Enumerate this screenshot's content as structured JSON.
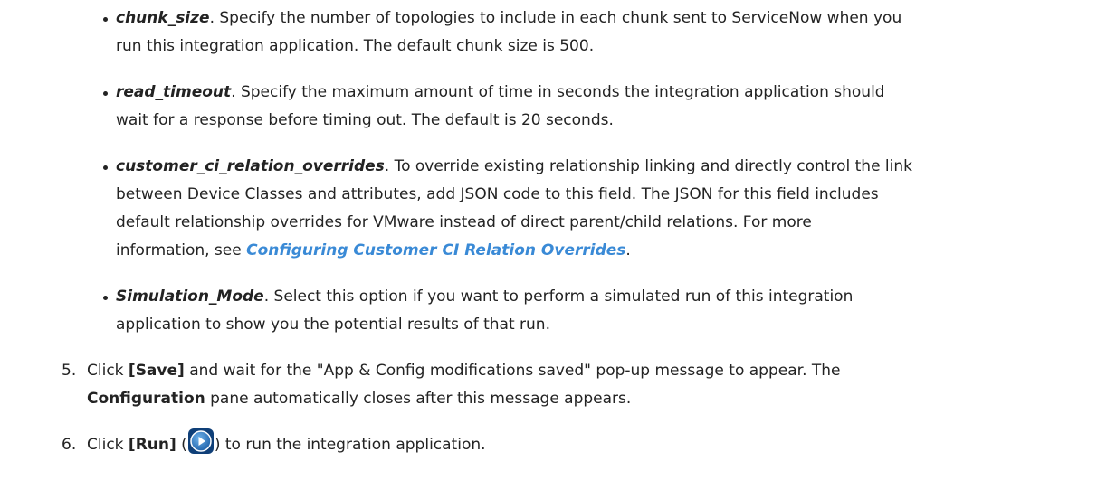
{
  "bullets": [
    {
      "term": "chunk_size",
      "line1": ". Specify the number of topologies to include in each chunk sent to ServiceNow when you",
      "line2": "run this integration application. The default chunk size is 500."
    },
    {
      "term": "read_timeout",
      "line1": ". Specify the maximum amount of time in seconds the integration application should",
      "line2": "wait for a response before timing out. The default is 20 seconds."
    },
    {
      "term": "customer_ci_relation_overrides",
      "line1": ". To override existing relationship linking and directly control the link",
      "line2": "between Device Classes and attributes, add JSON code to this field. The JSON for this field includes",
      "line3": "default relationship overrides for VMware instead of direct parent/child relations. For more",
      "line4_prefix": "information, see ",
      "link": "Configuring Customer CI Relation Overrides",
      "line4_suffix": "."
    },
    {
      "term": "Simulation_Mode",
      "line1": ". Select this option if you want to perform a simulated run of this integration",
      "line2": "application to show you the potential results of that run."
    }
  ],
  "steps": [
    {
      "number": "5.",
      "pre": "Click ",
      "button": "[Save]",
      "post": " and wait for the \"App & Config modifications saved\" pop-up message to appear. The",
      "cont_bold": "Configuration",
      "cont_rest": " pane automatically closes after this message appears."
    },
    {
      "number": "6.",
      "pre": "Click ",
      "button": "[Run]",
      "mid": " (",
      "icon": "run-play-icon",
      "post": ") to run the integration application."
    }
  ],
  "colors": {
    "text": "#232323",
    "link": "#3a8ad6",
    "icon_blue": "#1c5fa8"
  }
}
